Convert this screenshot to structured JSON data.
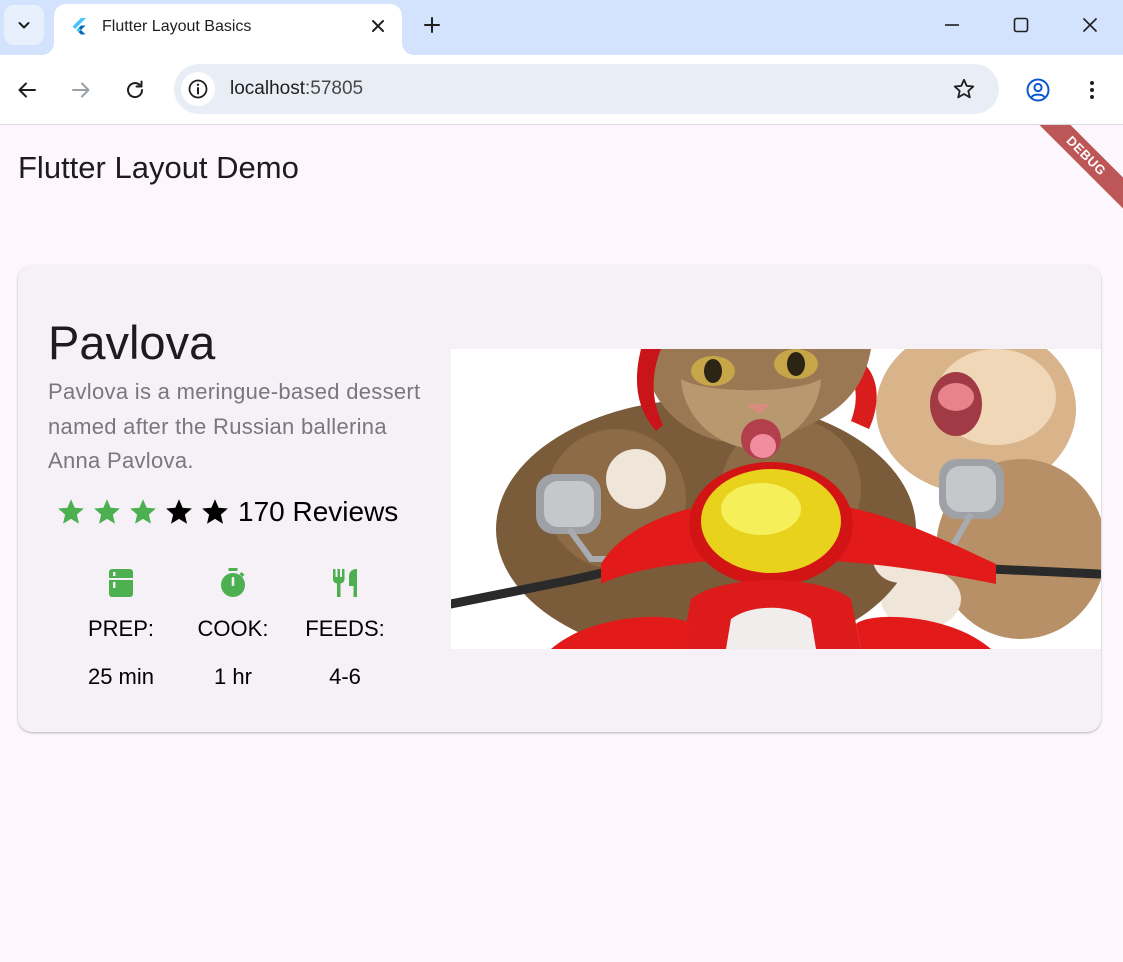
{
  "browser": {
    "tab_title": "Flutter Layout Basics",
    "url_host": "localhost",
    "url_port": ":57805"
  },
  "app": {
    "title": "Flutter Layout Demo",
    "debug_banner": "DEBUG"
  },
  "recipe": {
    "title": "Pavlova",
    "description": "Pavlova is a meringue-based dessert named after the Russian ballerina Anna Pavlova.",
    "rating": {
      "filled_stars": 3,
      "total_stars": 5,
      "reviews": "170 Reviews"
    },
    "stats": [
      {
        "icon": "kitchen-icon",
        "label": "PREP:",
        "value": "25 min"
      },
      {
        "icon": "timer-icon",
        "label": "COOK:",
        "value": "1 hr"
      },
      {
        "icon": "restaurant-icon",
        "label": "FEEDS:",
        "value": "4-6"
      }
    ],
    "image": "cats-riding-red-scooter-photo"
  },
  "colors": {
    "accent_green": "#4caf50",
    "page_bg": "#fdf7fd",
    "card_bg": "#f6f1f7",
    "tabbar_bg": "#d3e3fd",
    "debug_red": "#b13b3b"
  }
}
